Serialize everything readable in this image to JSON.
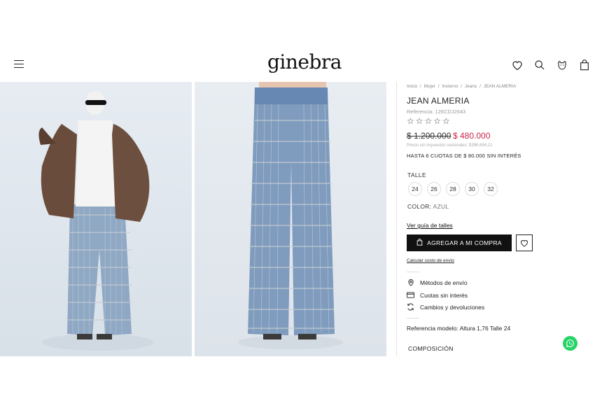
{
  "header": {
    "logo": "ginebra",
    "icons": [
      "menu-icon",
      "heart-icon",
      "search-icon",
      "user-icon",
      "bag-icon"
    ]
  },
  "gallery": {
    "images": [
      "model-wearing-fur-coat-and-fringe-jeans",
      "fringe-jeans-front-view"
    ]
  },
  "product": {
    "breadcrumb": [
      "Inicio",
      "/",
      "Mujer",
      "/",
      "Invierno",
      "/",
      "Jeans",
      "/",
      "JEAN ALMERIA"
    ],
    "title": "JEAN ALMERIA",
    "reference": "Referencia: 126CDJ2643",
    "stars": "☆☆☆☆☆",
    "price_old": "$ 1.200.000",
    "price_new": "$ 480.000",
    "tax_note": "Precio sin impuestos nacionales: $396.694,21",
    "installments": "HASTA 6 CUOTAS DE $ 80.000 SIN INTERÉS",
    "size_label": "TALLE",
    "sizes": [
      "24",
      "26",
      "28",
      "30",
      "32"
    ],
    "color_label": "COLOR:",
    "color_value": "AZUL",
    "size_guide": "Ver guía de talles",
    "add_button": "AGREGAR A MI COMPRA",
    "shipping_calc": "Calcular costo de envío",
    "features": [
      "Métodos de envío",
      "Cuotas sin interés",
      "Cambios y devoluciones"
    ],
    "model_reference": "Referencia modelo: Altura 1,76 Talle 24",
    "composition": "COMPOSICIÓN"
  },
  "colors": {
    "accent_price": "#c8264b",
    "button_bg": "#111111",
    "whatsapp": "#25d366"
  }
}
